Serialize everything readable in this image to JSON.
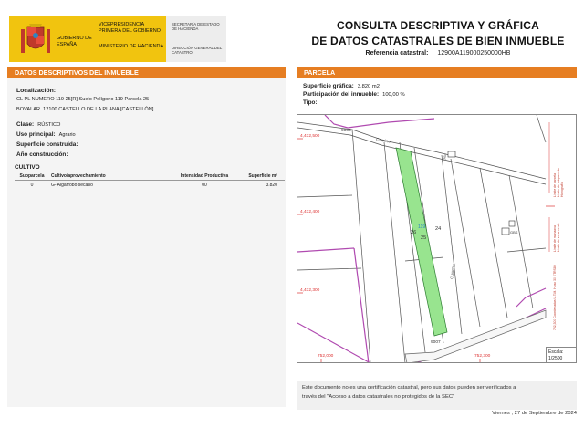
{
  "header": {
    "gov_name": "GOBIERNO DE ESPAÑA",
    "vice": "VICEPRESIDENCIA PRIMERA DEL GOBIERNO",
    "ministry": "MINISTERIO DE HACIENDA",
    "secretary": "SECRETARÍA DE ESTADO DE HACIENDA",
    "direction": "DIRECCIÓN GENERAL DEL CATASTRO",
    "title_line1": "CONSULTA DESCRIPTIVA Y GRÁFICA",
    "title_line2": "DE DATOS CATASTRALES DE BIEN INMUEBLE",
    "ref_label": "Referencia catastral:",
    "ref_value": "12900A119000250000HB"
  },
  "left": {
    "section_title": "DATOS DESCRIPTIVOS DEL INMUEBLE",
    "location_label": "Localización:",
    "location_line1": "CL PL NUMERO 119 25[R] Suelo Polígono 119 Parcela 25",
    "location_line2": "BOVALAR. 12100 CASTELLO DE LA PLANA [CASTELLÓN]",
    "clase_label": "Clase:",
    "clase_value": "RÚSTICO",
    "uso_label": "Uso principal:",
    "uso_value": "Agrario",
    "superficie_label": "Superficie construida:",
    "anio_label": "Año construcción:",
    "cultivo_title": "CULTIVO",
    "cultivo_headers": [
      "Subparcela",
      "Cultivo/aprovechamiento",
      "Intensidad Productiva",
      "Superficie m²"
    ],
    "cultivo_rows": [
      [
        "0",
        "G- Algarrobo secano",
        "00",
        "3.820"
      ]
    ]
  },
  "right": {
    "section_title": "PARCELA",
    "sup_label": "Superficie gráfica:",
    "sup_value": "3.820 m2",
    "part_label": "Participación del inmueble:",
    "part_value": "100,00 %",
    "tipo_label": "Tipo:",
    "map": {
      "coord_y1": "4,432,500",
      "coord_y2": "4,432,400",
      "coord_y3": "4,432,300",
      "coord_x1": "752,000",
      "coord_x2": "752,300",
      "parcel_num": "119",
      "lbl_24": "24",
      "lbl_25": "25",
      "lbl_26": "26",
      "lbl_9005": "9005",
      "lbl_9007": "9007",
      "lbl_camino": "Camino",
      "lbl_cuartel": "CUARTEL",
      "lbl_orto": "Orto",
      "lbl_gbs": "GBS",
      "parcel_color": "#98e48f"
    },
    "scale_label": "Escala:",
    "scale_value": "1/2500"
  },
  "footer": {
    "disclaimer_line1": "Este documento no es una certificación catastral, pero sus datos pueden ser verificados a",
    "disclaimer_line2": "través del \"Acceso a datos catastrales no protegidos de la SEC\"",
    "date": "Viernes , 27 de Septiembre de 2024"
  }
}
